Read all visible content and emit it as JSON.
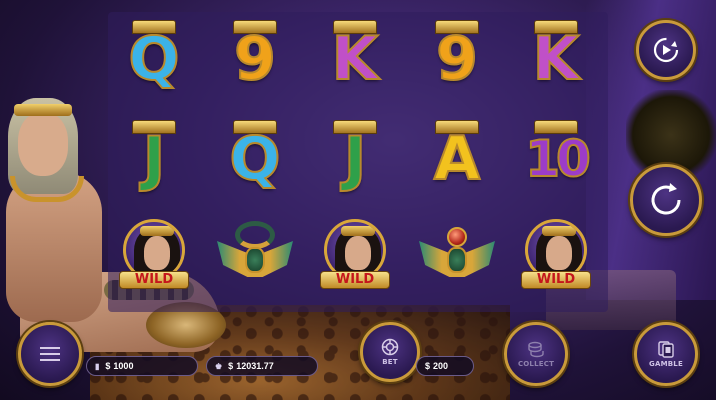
{
  "reels": [
    [
      {
        "type": "letter",
        "text": "Q",
        "color": "#3bb3e8"
      },
      {
        "type": "letter",
        "text": "J",
        "color": "#2fa04a"
      },
      {
        "type": "wild",
        "text": "WILD"
      }
    ],
    [
      {
        "type": "letter",
        "text": "9",
        "color": "#f0a21a"
      },
      {
        "type": "letter",
        "text": "Q",
        "color": "#3bb3e8"
      },
      {
        "type": "amulet",
        "name": "collar-amulet"
      }
    ],
    [
      {
        "type": "letter",
        "text": "K",
        "color": "#c050c8"
      },
      {
        "type": "letter",
        "text": "J",
        "color": "#2fa04a"
      },
      {
        "type": "wild",
        "text": "WILD"
      }
    ],
    [
      {
        "type": "letter",
        "text": "9",
        "color": "#f0a21a"
      },
      {
        "type": "letter",
        "text": "A",
        "color": "#f2c21e"
      },
      {
        "type": "amulet",
        "name": "scarab-amulet"
      }
    ],
    [
      {
        "type": "letter",
        "text": "K",
        "color": "#c050c8"
      },
      {
        "type": "letter",
        "text": "10",
        "color": "#9c3cc8"
      },
      {
        "type": "wild",
        "text": "WILD"
      }
    ]
  ],
  "controls": {
    "autoplay_icon": "autoplay-icon",
    "spin_icon": "spin-icon",
    "menu_icon": "hamburger-menu-icon",
    "bet_label": "BET",
    "collect_label": "COLLECT",
    "gamble_label": "GAMBLE"
  },
  "info": {
    "balance": {
      "icon": "wallet-icon",
      "currency": "$",
      "value": "1000"
    },
    "win": {
      "icon": "crown-icon",
      "currency": "$",
      "value": "12031.77"
    },
    "bet": {
      "currency": "$",
      "value": "200"
    }
  },
  "colors": {
    "gold": "#c99a3a",
    "button_fill": "#2a1950",
    "wild_text": "#c4161c"
  }
}
